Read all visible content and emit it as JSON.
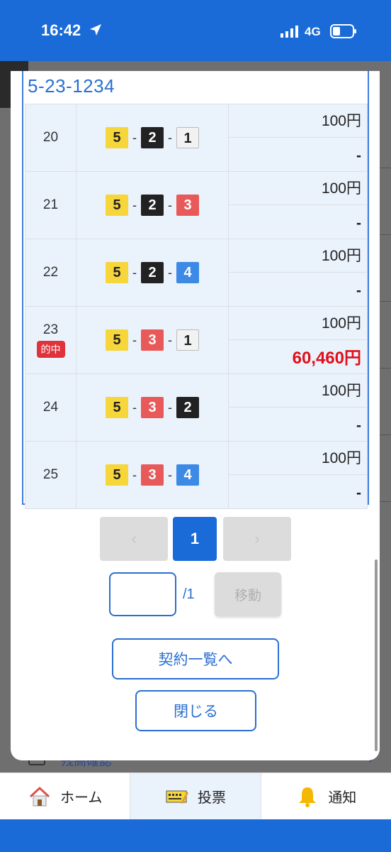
{
  "status": {
    "time": "16:42",
    "network": "4G"
  },
  "ticket": {
    "code": "5-23-1234"
  },
  "rows": [
    {
      "no": "20",
      "boats": [
        "5",
        "2",
        "1"
      ],
      "bet": "100円",
      "payout": "-",
      "hit": false
    },
    {
      "no": "21",
      "boats": [
        "5",
        "2",
        "3"
      ],
      "bet": "100円",
      "payout": "-",
      "hit": false
    },
    {
      "no": "22",
      "boats": [
        "5",
        "2",
        "4"
      ],
      "bet": "100円",
      "payout": "-",
      "hit": false
    },
    {
      "no": "23",
      "boats": [
        "5",
        "3",
        "1"
      ],
      "bet": "100円",
      "payout": "60,460円",
      "hit": true,
      "hit_label": "的中"
    },
    {
      "no": "24",
      "boats": [
        "5",
        "3",
        "2"
      ],
      "bet": "100円",
      "payout": "-",
      "hit": false
    },
    {
      "no": "25",
      "boats": [
        "5",
        "3",
        "4"
      ],
      "bet": "100円",
      "payout": "-",
      "hit": false
    }
  ],
  "combo_sep": "-",
  "pagination": {
    "prev": "‹",
    "current": "1",
    "next": "›",
    "input_value": "",
    "total": "/1",
    "move_label": "移動"
  },
  "actions": {
    "contract_list": "契約一覧へ",
    "close": "閉じる"
  },
  "background": {
    "peek_text": "残高確認"
  },
  "tabs": [
    {
      "label": "ホーム",
      "icon": "home-icon",
      "active": false
    },
    {
      "label": "投票",
      "icon": "ticket-icon",
      "active": true
    },
    {
      "label": "通知",
      "icon": "bell-icon",
      "active": false
    }
  ],
  "colors": {
    "brand": "#1a6ad8",
    "hit": "#e0323a",
    "payout_win": "#e0101a",
    "boat_1": "#f2f2f2",
    "boat_2": "#222222",
    "boat_3": "#e85a5a",
    "boat_4": "#3d8ae6",
    "boat_5": "#f6d63b"
  }
}
